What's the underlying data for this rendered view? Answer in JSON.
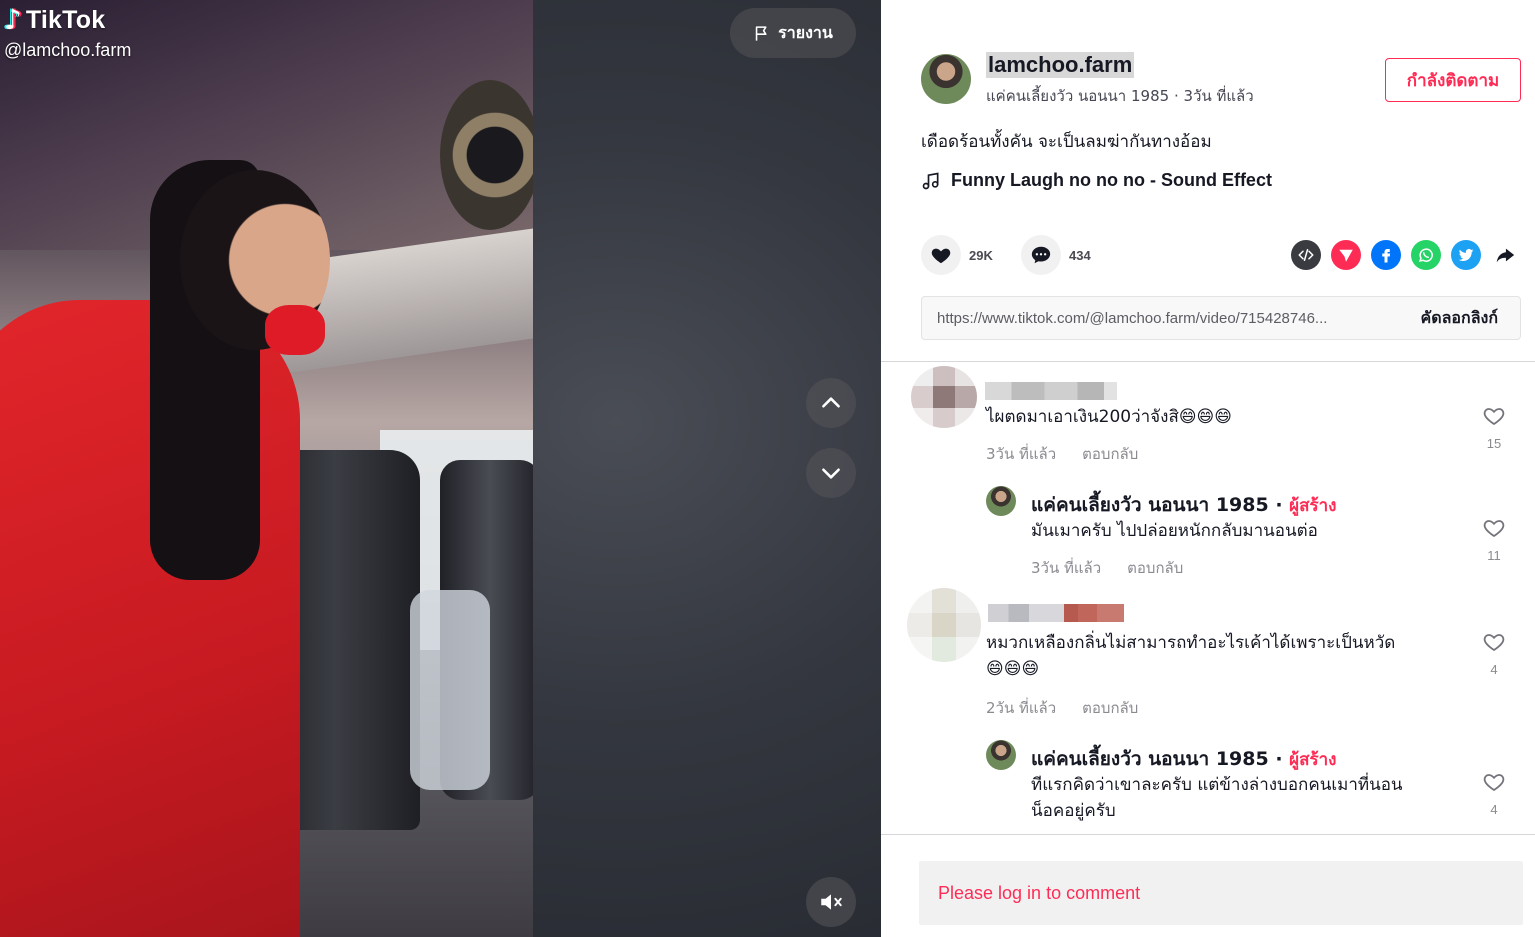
{
  "video": {
    "watermark_logo": "TikTok",
    "watermark_handle": "@lamchoo.farm",
    "report_label": "รายงาน"
  },
  "author": {
    "username": "lamchoo.farm",
    "display_name": "แค่คนเลี้ยงวัว นอนนา 1985",
    "posted": "3วัน ที่แล้ว",
    "subline": "แค่คนเลี้ยงวัว นอนนา 1985 · 3วัน ที่แล้ว",
    "follow_label": "กำลังติดตาม"
  },
  "caption": "เดือดร้อนทั้งคัน จะเป็นลมฆ่ากันทางอ้อม",
  "music": {
    "title": "Funny Laugh no no no - Sound Effect"
  },
  "stats": {
    "likes": "29K",
    "comments": "434"
  },
  "share_icons": [
    "embed-icon",
    "send-icon",
    "facebook-icon",
    "whatsapp-icon",
    "twitter-icon",
    "share-arrow-icon"
  ],
  "link": {
    "url": "https://www.tiktok.com/@lamchoo.farm/video/715428746...",
    "copy_label": "คัดลอกลิงก์"
  },
  "comments": [
    {
      "text": "ไผตดมาเอาเงิน200ว่าจังสิ😄😄😄",
      "time": "3วัน ที่แล้ว",
      "reply_label": "ตอบกลับ",
      "likes": "15",
      "reply": {
        "name": "แค่คนเลี้ยงวัว นอนนา 1985",
        "creator_badge": "ผู้สร้าง",
        "text": "มันเมาครับ ไปปล่อยหนักกลับมานอนต่อ",
        "time": "3วัน ที่แล้ว",
        "reply_label": "ตอบกลับ",
        "likes": "11"
      }
    },
    {
      "text_line1": "หมวกเหลืองกลิ่นไม่สามารถทำอะไรเค้าได้เพราะเป็นหวัด",
      "text_line2": "😄😄😄",
      "time": "2วัน ที่แล้ว",
      "reply_label": "ตอบกลับ",
      "likes": "4",
      "reply": {
        "name": "แค่คนเลี้ยงวัว นอนนา 1985",
        "creator_badge": "ผู้สร้าง",
        "text_line1": "ทีแรกคิดว่าเขาละครับ แต่ข้างล่างบอกคนเมาที่นอน",
        "text_line2": "น็อคอยู่ครับ",
        "likes": "4"
      }
    }
  ],
  "login_prompt": "Please log in to comment",
  "colors": {
    "accent": "#fe2c55",
    "text": "#161823",
    "muted": "#8a8b91"
  }
}
